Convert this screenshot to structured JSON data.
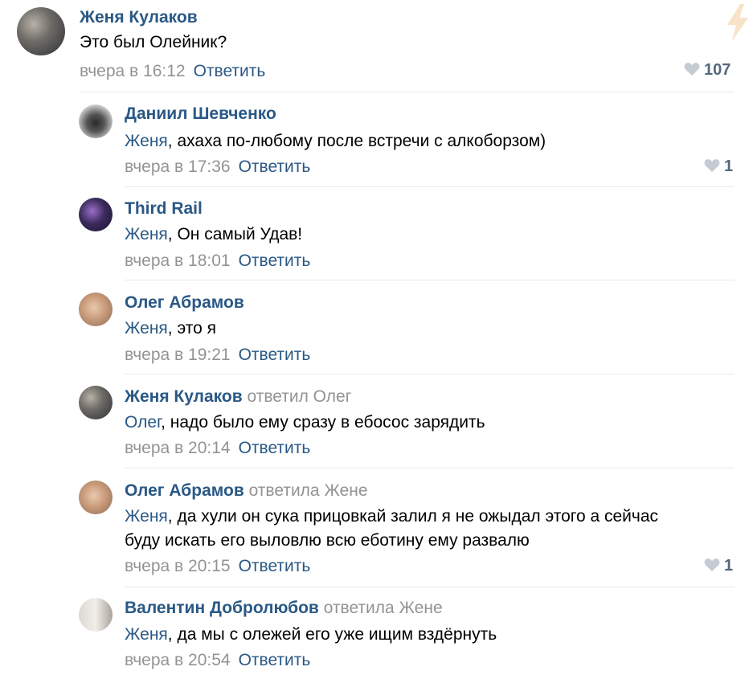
{
  "root": {
    "author": "Женя Кулаков",
    "text": "Это был Олейник?",
    "date": "вчера в 16:12",
    "reply_label": "Ответить",
    "likes": "107"
  },
  "replies": [
    {
      "author": "Даниил Шевченко",
      "reply_to": "",
      "mention": "Женя",
      "text": ", ахаха по-любому после встречи с алкоборзом)",
      "date": "вчера в 17:36",
      "reply_label": "Ответить",
      "likes": "1"
    },
    {
      "author": "Third Rail",
      "reply_to": "",
      "mention": "Женя",
      "text": ", Он самый Удав!",
      "date": "вчера в 18:01",
      "reply_label": "Ответить",
      "likes": ""
    },
    {
      "author": "Олег Абрамов",
      "reply_to": "",
      "mention": "Женя",
      "text": ", это я",
      "date": "вчера в 19:21",
      "reply_label": "Ответить",
      "likes": ""
    },
    {
      "author": "Женя Кулаков",
      "reply_to": "ответил Олег",
      "mention": "Олег",
      "text": ", надо было ему сразу в ебосос зарядить",
      "date": "вчера в 20:14",
      "reply_label": "Ответить",
      "likes": ""
    },
    {
      "author": "Олег Абрамов",
      "reply_to": "ответила Жене",
      "mention": "Женя",
      "text": ", да хули он сука прицовкай залил я не ожыдал этого а сейчас",
      "text_line2": "буду искать его выловлю всю еботину ему развалю",
      "date": "вчера в 20:15",
      "reply_label": "Ответить",
      "likes": "1"
    },
    {
      "author": "Валентин Добролюбов",
      "reply_to": "ответила Жене",
      "mention": "Женя",
      "text": ", да мы с олежей его уже ищим вздёрнуть",
      "date": "вчера в 20:54",
      "reply_label": "Ответить",
      "likes": ""
    }
  ],
  "icons": {
    "like": "heart-icon",
    "corner": "lightning-icon"
  },
  "colors": {
    "link": "#2a5885",
    "meta": "#939393",
    "likes": "#55677d",
    "divider": "#e7e8ec"
  }
}
